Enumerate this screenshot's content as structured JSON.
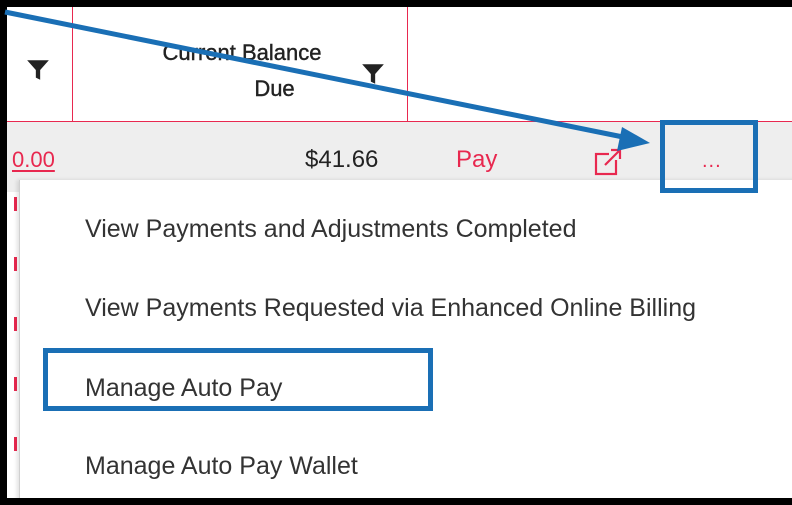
{
  "table": {
    "header": {
      "current_balance_line1": "Current Balance",
      "current_balance_line2": "Due",
      "filter_icon": "filter-icon"
    },
    "row": {
      "amount_link": "0.00",
      "current_balance": "$41.66",
      "pay_label": "Pay",
      "open_icon": "external-link-icon",
      "more_label": "..."
    }
  },
  "menu": {
    "items": [
      {
        "label": "View Payments and Adjustments Completed"
      },
      {
        "label": "View Payments Requested via Enhanced Online Billing"
      },
      {
        "label": "Manage Auto Pay"
      },
      {
        "label": "Manage Auto Pay Wallet"
      }
    ]
  },
  "annotation": {
    "highlight_color": "#1a6fb5",
    "accent_color": "#e8284f"
  }
}
